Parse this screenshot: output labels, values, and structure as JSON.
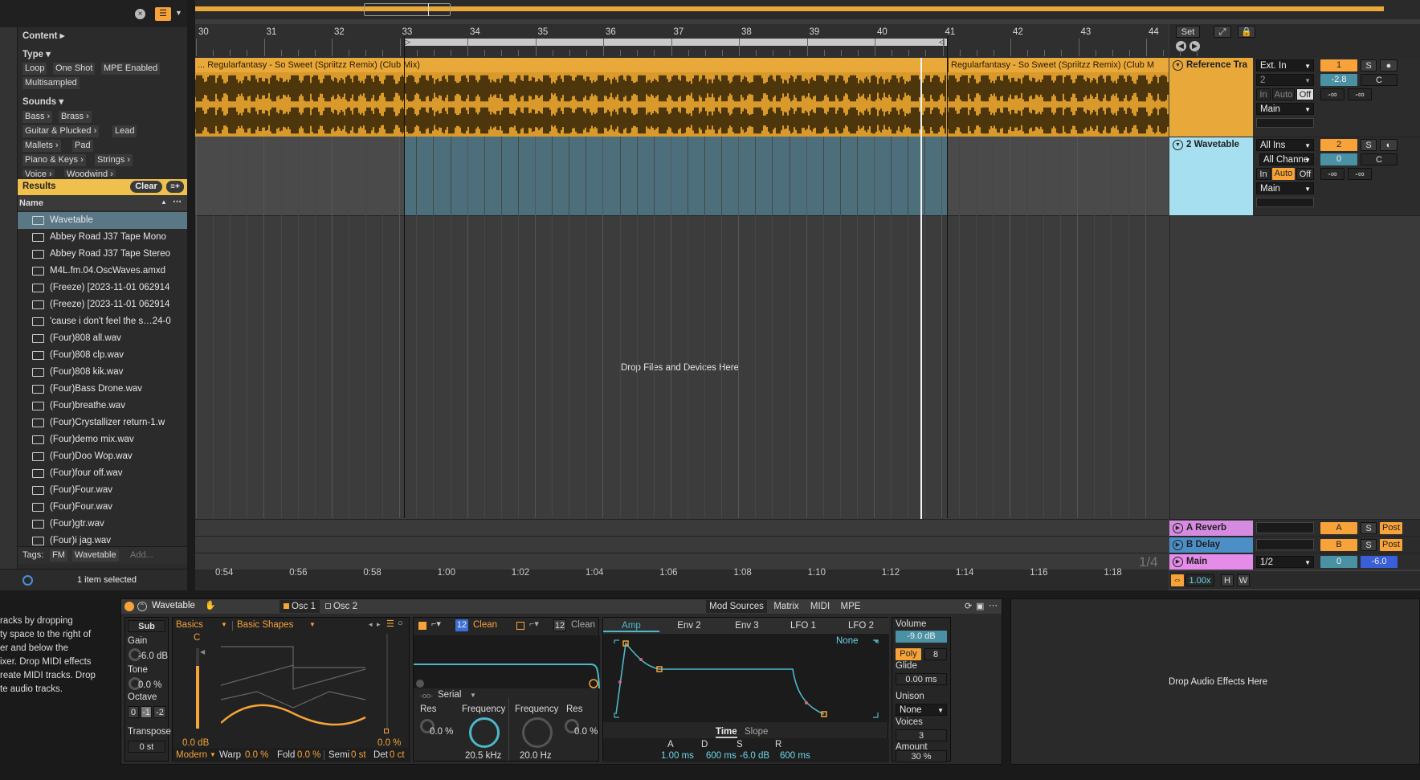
{
  "browser": {
    "content_label": "Content ▸",
    "type_label": "Type ▾",
    "type_tags": [
      "Loop",
      "One Shot",
      "MPE Enabled",
      "Multisampled"
    ],
    "sounds_label": "Sounds ▾",
    "sound_tags": [
      "Bass ›",
      "Brass ›",
      "Guitar & Plucked ›",
      "Lead",
      "Mallets ›",
      "Pad",
      "Piano & Keys ›",
      "Strings ›",
      "Voice ›",
      "Woodwind ›"
    ],
    "results_label": "Results",
    "clear_label": "Clear",
    "name_header": "Name",
    "files": [
      "Wavetable",
      "Abbey Road J37 Tape Mono",
      "Abbey Road J37 Tape Stereo",
      "M4L.fm.04.OscWaves.amxd",
      "(Freeze) [2023-11-01 062914",
      "(Freeze) [2023-11-01 062914",
      "'cause i don't feel the s…24-0",
      "(Four)808 all.wav",
      "(Four)808 clp.wav",
      "(Four)808 kik.wav",
      "(Four)Bass Drone.wav",
      "(Four)breathe.wav",
      "(Four)Crystallizer return-1.w",
      "(Four)demo mix.wav",
      "(Four)Doo Wop.wav",
      "(Four)four off.wav",
      "(Four)Four.wav",
      "(Four)Four.wav",
      "(Four)gtr.wav",
      "(Four)i jag.wav"
    ],
    "tags_label": "Tags:",
    "tag_items": [
      "FM",
      "Wavetable",
      "Add..."
    ],
    "status": "1 item selected"
  },
  "arrangement": {
    "bars": [
      "30",
      "31",
      "32",
      "33",
      "34",
      "35",
      "36",
      "37",
      "38",
      "39",
      "40",
      "41",
      "42",
      "43",
      "44"
    ],
    "set_label": "Set",
    "clip1_name": "... Regularfantasy - So Sweet (Spriitzz Remix) (Club Mix)",
    "clip2_name": "Regularfantasy - So Sweet (Spriitzz Remix) (Club M",
    "drop_text": "Drop Files and Devices Here",
    "times": [
      "0:54",
      "0:56",
      "0:58",
      "1:00",
      "1:02",
      "1:04",
      "1:06",
      "1:08",
      "1:10",
      "1:12",
      "1:14",
      "1:16",
      "1:18"
    ],
    "grid": "1/4",
    "zoom": "1.00x",
    "h_label": "H",
    "w_label": "W"
  },
  "tracks": {
    "ref": {
      "name": "Reference Tra",
      "input": "Ext. In",
      "channel": "2",
      "monitor_in": "In",
      "monitor_auto": "Auto",
      "monitor_off": "Off",
      "output": "Main",
      "number": "1",
      "solo": "S",
      "vol": "-2.8",
      "pan": "C",
      "peak1": "-∞",
      "peak2": "-∞"
    },
    "wt": {
      "name": "2 Wavetable",
      "input": "All Ins",
      "channel": "All Channe",
      "monitor_in": "In",
      "monitor_auto": "Auto",
      "monitor_off": "Off",
      "output": "Main",
      "number": "2",
      "solo": "S",
      "vol": "0",
      "pan": "C",
      "peak1": "-∞",
      "peak2": "-∞"
    },
    "reverb": {
      "name": "A Reverb",
      "letter": "A",
      "solo": "S",
      "post": "Post"
    },
    "delay": {
      "name": "B Delay",
      "letter": "B",
      "solo": "S",
      "post": "Post"
    },
    "main": {
      "name": "Main",
      "cue": "1/2",
      "vol": "0",
      "db": "-6.0"
    }
  },
  "info": [
    "racks by dropping",
    "ty space to the right of",
    "er and below the",
    "ixer. Drop MIDI effects",
    "reate MIDI tracks. Drop",
    "te audio tracks."
  ],
  "device": {
    "title": "Wavetable",
    "osc1": "Osc 1",
    "osc2": "Osc 2",
    "tabs": [
      "Mod Sources",
      "Matrix",
      "MIDI",
      "MPE"
    ],
    "sub": "Sub",
    "gain_label": "Gain",
    "gain_val": "-6.0 dB",
    "tone_label": "Tone",
    "tone_val": "0.0 %",
    "octave_label": "Octave",
    "octaves": [
      "0",
      "-1",
      "-2"
    ],
    "transpose_label": "Transpose",
    "transpose_val": "0 st",
    "category": "Basics",
    "wavetable": "Basic Shapes",
    "pitch_note": "C",
    "osc_gain": "0.0 dB",
    "osc_pos": "0.0 %",
    "mode": "Modern",
    "warp_label": "Warp",
    "warp_val": "0.0 %",
    "fold_label": "Fold",
    "fold_val": "0.0 %",
    "semi_label": "Semi",
    "semi_val": "0 st",
    "det_label": "Det",
    "det_val": "0 ct",
    "filter1_slope": "12",
    "filter1_circuit": "Clean",
    "filter2_slope": "12",
    "filter2_circuit": "Clean",
    "routing": "Serial",
    "f1_res_label": "Res",
    "f1_res": "0.0 %",
    "f1_freq_label": "Frequency",
    "f1_freq": "20.5 kHz",
    "f2_freq_label": "Frequency",
    "f2_freq": "20.0 Hz",
    "f2_res_label": "Res",
    "f2_res": "0.0 %",
    "mod_tabs": [
      "Amp",
      "Env 2",
      "Env 3",
      "LFO 1",
      "LFO 2"
    ],
    "env_target": "None",
    "time_label": "Time",
    "slope_label": "Slope",
    "adsr_labels": [
      "A",
      "D",
      "S",
      "R"
    ],
    "adsr_vals": [
      "1.00 ms",
      "600 ms",
      "-6.0 dB",
      "600 ms"
    ],
    "volume_label": "Volume",
    "volume_val": "-9.0 dB",
    "poly": "Poly",
    "voices_n": "8",
    "glide_label": "Glide",
    "glide_val": "0.00 ms",
    "unison_label": "Unison",
    "unison_val": "None",
    "voices_label": "Voices",
    "voices_val": "3",
    "amount_label": "Amount",
    "amount_val": "30 %"
  },
  "fx_drop": "Drop Audio Effects Here",
  "colors": {
    "orange": "#f7a33a",
    "clip": "#e8a93a",
    "blue": "#4db8c9",
    "wavetable_track": "#a6dff0"
  }
}
